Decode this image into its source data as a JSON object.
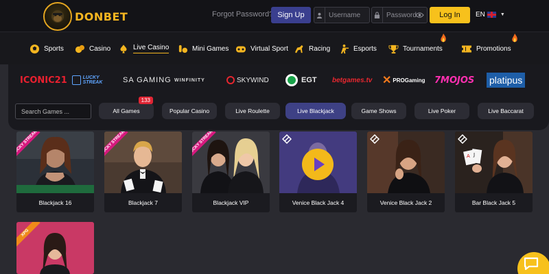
{
  "header": {
    "logo_text": "DONBET",
    "forgot_password": "Forgot Password?",
    "signup_label": "Sign Up",
    "username_placeholder": "Username",
    "password_placeholder": "Password",
    "login_label": "Log In",
    "language": "EN"
  },
  "nav": {
    "items": [
      {
        "label": "Sports",
        "icon": "soccer-ball-icon"
      },
      {
        "label": "Casino",
        "icon": "coins-icon"
      },
      {
        "label": "Live Casino",
        "icon": "spade-icon",
        "active": true
      },
      {
        "label": "Mini Games",
        "icon": "bowling-icon"
      },
      {
        "label": "Virtual Sport",
        "icon": "gamepad-icon"
      },
      {
        "label": "Racing",
        "icon": "horse-icon"
      },
      {
        "label": "Esports",
        "icon": "shooter-icon"
      },
      {
        "label": "Tournaments",
        "icon": "trophy-icon"
      },
      {
        "label": "Promotions",
        "icon": "ticket-icon"
      }
    ]
  },
  "providers": [
    "ICONIC21",
    "LUCKY STREAK",
    "SA GAMING",
    "WINFINITY",
    "SKYWIND",
    "EGT",
    "betgames.tv",
    "PROGaming",
    "7MOJOS",
    "platipus"
  ],
  "filters": {
    "search_placeholder": "Search Games ...",
    "tabs": [
      {
        "label": "All Games",
        "badge": "133"
      },
      {
        "label": "Popular Casino"
      },
      {
        "label": "Live Roulette"
      },
      {
        "label": "Live Blackjack",
        "active": true
      },
      {
        "label": "Game Shows"
      },
      {
        "label": "Live Poker"
      },
      {
        "label": "Live Baccarat"
      }
    ]
  },
  "games": [
    {
      "title": "Blackjack 16",
      "ribbon": "LUCKY STREAK"
    },
    {
      "title": "Blackjack 7",
      "ribbon": "LUCKY STREAK"
    },
    {
      "title": "Blackjack VIP",
      "ribbon": "LUCKY STREAK"
    },
    {
      "title": "Venice Black Jack 4",
      "ribbon": ""
    },
    {
      "title": "Venice Black Jack 2",
      "ribbon": ""
    },
    {
      "title": "Bar Black Jack 5",
      "ribbon": ""
    },
    {
      "title": "",
      "ribbon": "XPG"
    }
  ],
  "colors": {
    "accent": "#f7c11c",
    "active_tab": "#3e4185",
    "badge": "#e02534",
    "ribbon": "#d6197e"
  }
}
